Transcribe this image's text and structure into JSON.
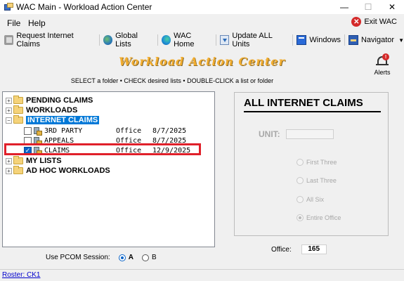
{
  "window": {
    "title": "WAC Main - Workload Action Center",
    "minimize": "—",
    "maximize": "☐",
    "close": "✕"
  },
  "menu": {
    "file": "File",
    "help": "Help",
    "exit": "Exit WAC"
  },
  "toolbar": {
    "items": [
      {
        "label": "Request Internet Claims",
        "icon": "request-icon"
      },
      {
        "label": "Global Lists",
        "icon": "globe-icon"
      },
      {
        "label": "WAC Home",
        "icon": "edge-icon"
      },
      {
        "label": "Update ALL Units",
        "icon": "update-icon"
      },
      {
        "label": "Windows",
        "icon": "windows-icon"
      },
      {
        "label": "Navigator",
        "icon": "navigator-icon"
      }
    ],
    "navigator_caret": "▼"
  },
  "banner": "Workload Action Center",
  "instructions": "SELECT a folder  •  CHECK desired lists  •  DOUBLE-CLICK a list or folder",
  "alerts": {
    "label": "Alerts",
    "badge": "!"
  },
  "tree": {
    "folders": [
      {
        "label": "PENDING CLAIMS",
        "expander": "+"
      },
      {
        "label": "WORKLOADS",
        "expander": "+"
      },
      {
        "label": "INTERNET CLAIMS",
        "expander": "−"
      },
      {
        "label": "MY LISTS",
        "expander": "+"
      },
      {
        "label": "AD HOC WORKLOADS",
        "expander": "+"
      }
    ],
    "items": [
      {
        "name": "3RD PARTY",
        "office": "Office",
        "date": "8/7/2025",
        "checked": false
      },
      {
        "name": "APPEALS",
        "office": "Office",
        "date": "8/7/2025",
        "checked": false
      },
      {
        "name": "CLAIMS",
        "office": "Office",
        "date": "12/9/2025",
        "checked": true
      }
    ]
  },
  "pcom": {
    "label": "Use PCOM Session:",
    "options": [
      "A",
      "B"
    ],
    "selected": "A"
  },
  "right_panel": {
    "title": "ALL INTERNET CLAIMS",
    "unit_label": "UNIT:",
    "unit_value": "",
    "options": [
      "First Three",
      "Last Three",
      "All Six",
      "Entire Office"
    ],
    "selected_option": "Entire Office"
  },
  "office": {
    "label": "Office:",
    "value": "165"
  },
  "status": {
    "roster": "Roster: CK1"
  },
  "colors": {
    "banner": "#f2ad2f",
    "selection": "#0078d7",
    "highlight": "#e0202a",
    "link": "#0000cc"
  }
}
